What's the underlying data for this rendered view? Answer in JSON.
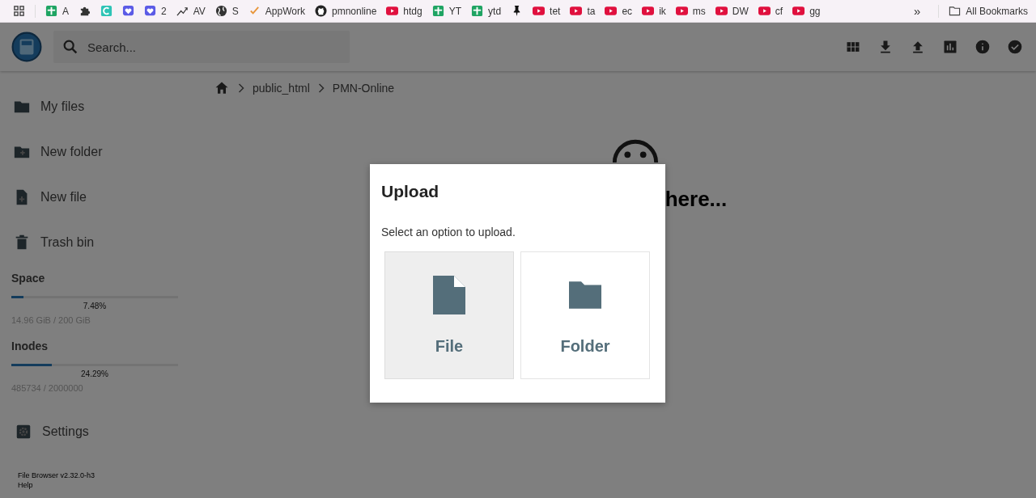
{
  "bookmarks": [
    {
      "kind": "apps"
    },
    {
      "kind": "sheet",
      "label": "A"
    },
    {
      "kind": "puzzle"
    },
    {
      "kind": "tile"
    },
    {
      "kind": "heart"
    },
    {
      "kind": "heart",
      "label": "2"
    },
    {
      "kind": "trend",
      "label": "AV"
    },
    {
      "kind": "globe",
      "label": "S"
    },
    {
      "kind": "check",
      "label": "AppWork"
    },
    {
      "kind": "github",
      "label": "pmnonline"
    },
    {
      "kind": "video",
      "label": "htdg"
    },
    {
      "kind": "sheet",
      "label": "YT"
    },
    {
      "kind": "sheet",
      "label": "ytd"
    },
    {
      "kind": "pin"
    },
    {
      "kind": "video",
      "label": "tet"
    },
    {
      "kind": "video",
      "label": "ta"
    },
    {
      "kind": "video",
      "label": "ec"
    },
    {
      "kind": "video",
      "label": "ik"
    },
    {
      "kind": "video",
      "label": "ms"
    },
    {
      "kind": "video",
      "label": "DW"
    },
    {
      "kind": "video",
      "label": "cf"
    },
    {
      "kind": "video",
      "label": "gg"
    }
  ],
  "bookmarks_more": "»",
  "all_bookmarks": "All Bookmarks",
  "search": {
    "placeholder": "Search..."
  },
  "toolbar": [
    {
      "kind": "grid"
    },
    {
      "kind": "download"
    },
    {
      "kind": "upload"
    },
    {
      "kind": "chart"
    },
    {
      "kind": "info"
    },
    {
      "kind": "check"
    }
  ],
  "sidebar": {
    "items": [
      {
        "kind": "folder",
        "label": "My files"
      },
      {
        "kind": "newfolder",
        "label": "New folder"
      },
      {
        "kind": "newfile",
        "label": "New file"
      },
      {
        "kind": "trash",
        "label": "Trash bin"
      }
    ],
    "usage": [
      {
        "title": "Space",
        "level": 0.0748,
        "percent": "7.48%",
        "detail": "14.96 GiB / 200 GiB"
      },
      {
        "title": "Inodes",
        "level": 0.2429,
        "percent": "24.29%",
        "detail": "485734 / 2000000"
      }
    ],
    "settings": "Settings",
    "footer": [
      "File Browser v2.32.0-h3",
      "Help"
    ]
  },
  "breadcrumbs": [
    "public_html",
    "PMN-Online"
  ],
  "empty_message": "here...",
  "dialog": {
    "title": "Upload",
    "text": "Select an option to upload.",
    "options": [
      {
        "kind": "file",
        "label": "File",
        "highlighted": true
      },
      {
        "kind": "folder",
        "label": "Folder",
        "highlighted": false
      }
    ]
  }
}
